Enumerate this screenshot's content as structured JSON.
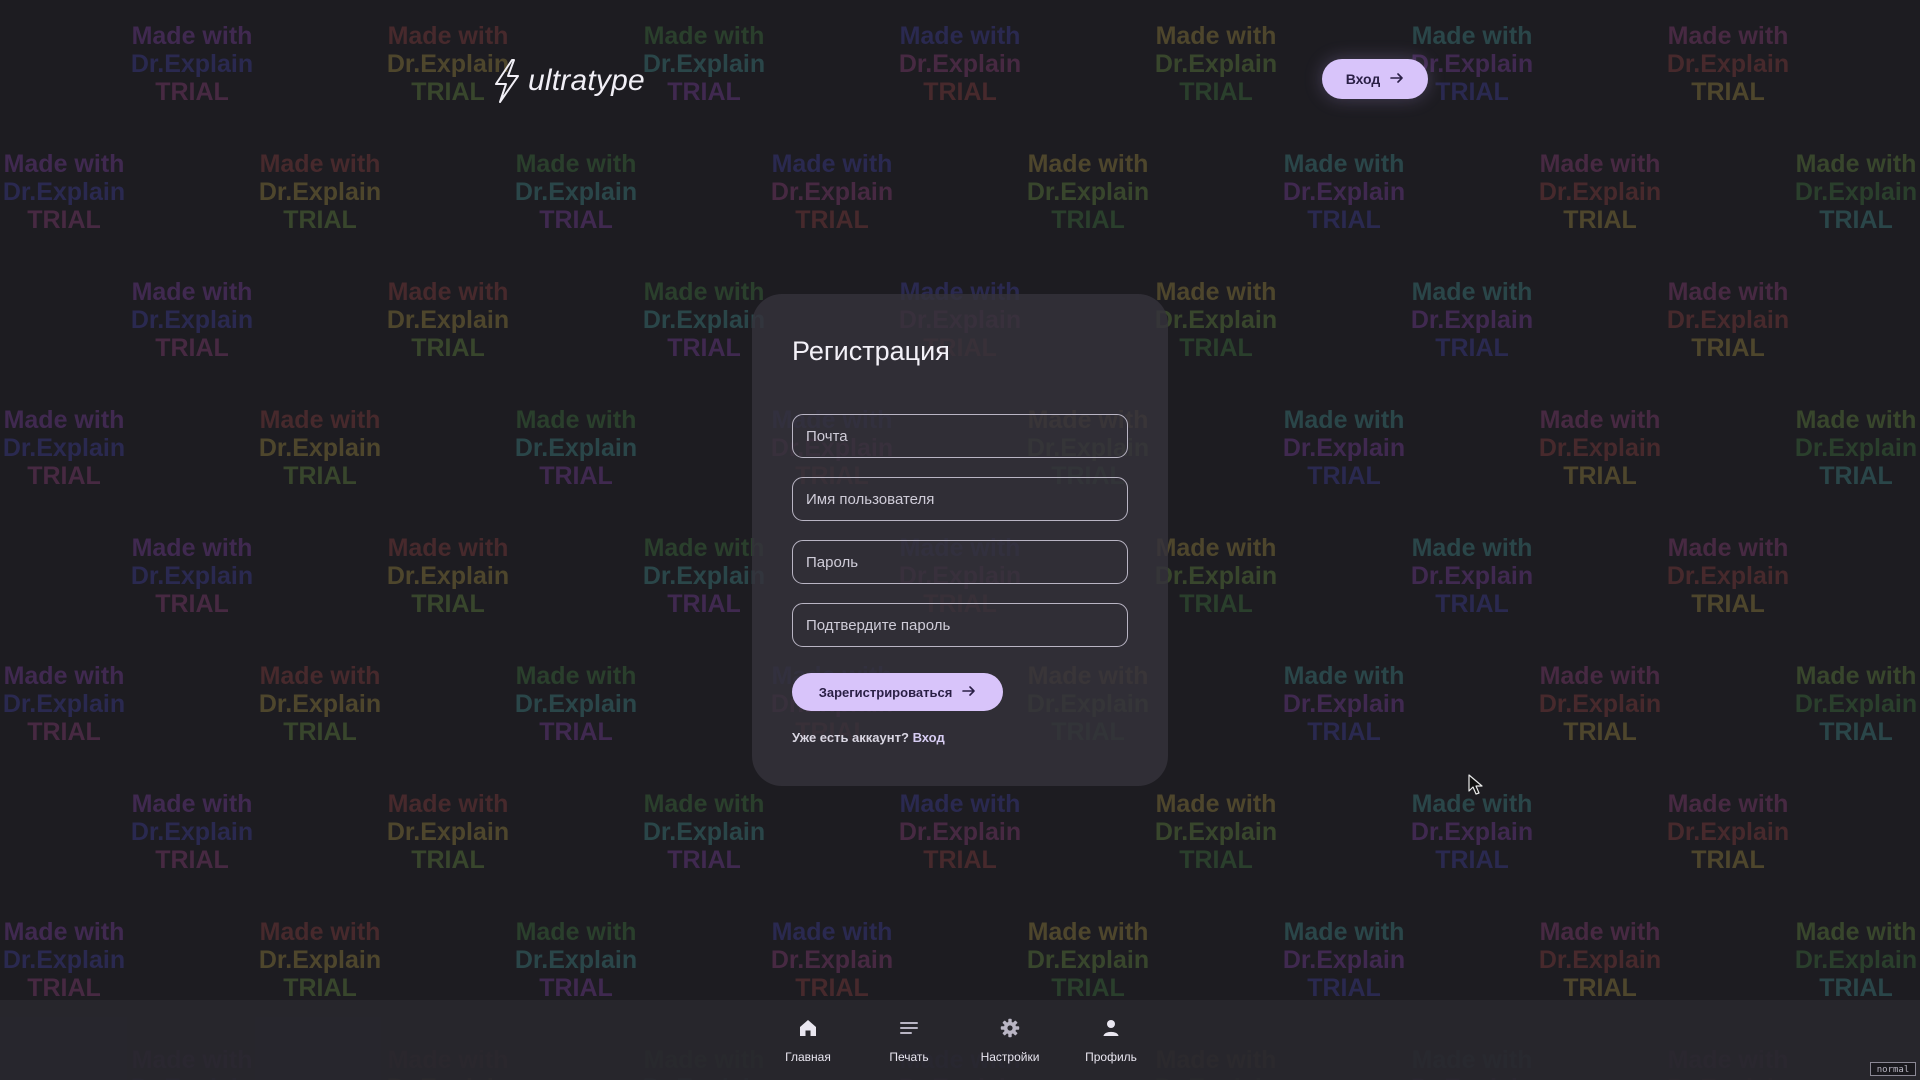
{
  "watermark": {
    "lines": [
      "Made with",
      "Dr.Explain",
      "TRIAL"
    ],
    "colors": [
      "#6b3a8a",
      "#7a3a3a",
      "#3a6a3a",
      "#3a3a8a",
      "#8a7a3a",
      "#3a7a7a",
      "#7a3a6a",
      "#5a7a3a"
    ]
  },
  "header": {
    "logo_text": "ultratype",
    "login_label": "Вход"
  },
  "registration": {
    "title": "Регистрация",
    "email_placeholder": "Почта",
    "username_placeholder": "Имя пользователя",
    "password_placeholder": "Пароль",
    "confirm_placeholder": "Подтвердите пароль",
    "submit_label": "Зарегистрироваться",
    "have_account_text": "Уже есть аккаунт?",
    "login_link": "Вход"
  },
  "bottom_nav": {
    "items": [
      {
        "label": "Главная",
        "icon": "home-icon"
      },
      {
        "label": "Печать",
        "icon": "lines-icon"
      },
      {
        "label": "Настройки",
        "icon": "gear-icon"
      },
      {
        "label": "Профиль",
        "icon": "user-icon"
      }
    ]
  },
  "status_badge": "normal",
  "colors": {
    "background": "#1d1c21",
    "card": "#34323b",
    "accent": "#d8c4fa",
    "accent_text": "#2a1f45"
  }
}
